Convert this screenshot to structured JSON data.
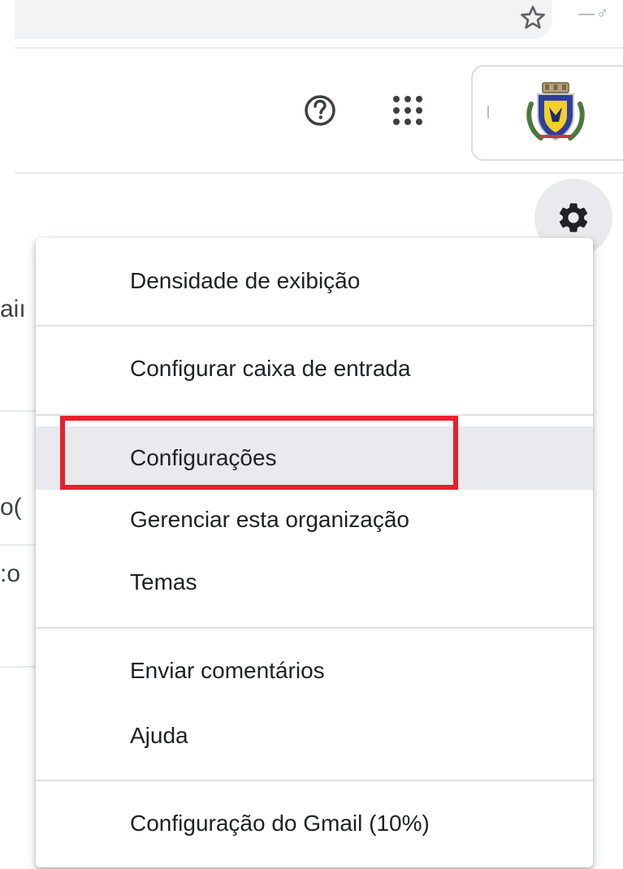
{
  "header": {
    "help_icon": "help-circle-icon",
    "apps_icon": "apps-grid-icon",
    "settings_icon": "gear-icon",
    "star_icon": "bookmark-star-icon",
    "extension_fragment": "—♂",
    "avatar_icon": "municipal-crest-avatar"
  },
  "background_fragments": [
    "aiı",
    "o(",
    ":o"
  ],
  "menu": {
    "items": [
      {
        "label": "Densidade de exibição"
      },
      {
        "label": "Configurar caixa de entrada"
      },
      {
        "label": "Configurações"
      },
      {
        "label": "Gerenciar esta organização"
      },
      {
        "label": "Temas"
      },
      {
        "label": "Enviar comentários"
      },
      {
        "label": "Ajuda"
      },
      {
        "label": "Configuração do Gmail (10%)"
      }
    ],
    "highlighted_item": "Configurações",
    "highlight_color": "#e8202a"
  },
  "colors": {
    "hover_bg": "#e8eaed",
    "text": "#202124",
    "icon": "#3c4043"
  }
}
